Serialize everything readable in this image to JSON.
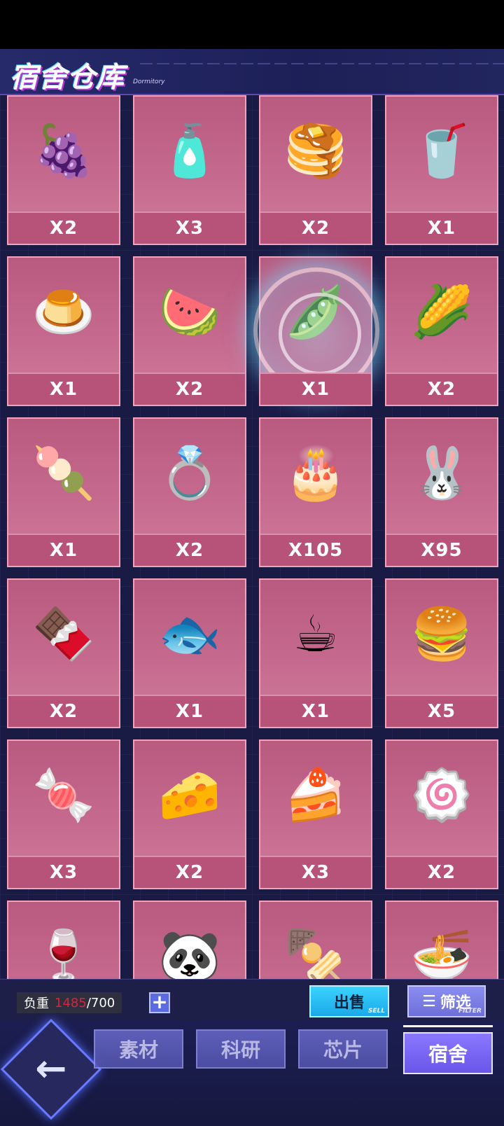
{
  "header": {
    "title": "宿舍仓库",
    "subtitle": "Dormitory"
  },
  "items": [
    {
      "icon": "🍇",
      "qty": "X2"
    },
    {
      "icon": "🧴",
      "qty": "X3"
    },
    {
      "icon": "🥞",
      "qty": "X2"
    },
    {
      "icon": "🥤",
      "qty": "X1"
    },
    {
      "icon": "🍮",
      "qty": "X1"
    },
    {
      "icon": "🍉",
      "qty": "X2"
    },
    {
      "icon": "🫛",
      "qty": "X1"
    },
    {
      "icon": "🌽",
      "qty": "X2"
    },
    {
      "icon": "🍡",
      "qty": "X1"
    },
    {
      "icon": "💍",
      "qty": "X2"
    },
    {
      "icon": "🎂",
      "qty": "X105"
    },
    {
      "icon": "🐰",
      "qty": "X95"
    },
    {
      "icon": "🍫",
      "qty": "X2"
    },
    {
      "icon": "🐟",
      "qty": "X1"
    },
    {
      "icon": "☕",
      "qty": "X1"
    },
    {
      "icon": "🍔",
      "qty": "X5"
    },
    {
      "icon": "🍬",
      "qty": "X3"
    },
    {
      "icon": "🧀",
      "qty": "X2"
    },
    {
      "icon": "🍰",
      "qty": "X3"
    },
    {
      "icon": "🍥",
      "qty": "X2"
    },
    {
      "icon": "🍷",
      "qty": ""
    },
    {
      "icon": "🐼",
      "qty": ""
    },
    {
      "icon": "🍢",
      "qty": ""
    },
    {
      "icon": "🍜",
      "qty": ""
    }
  ],
  "footer": {
    "weight_label": "负重",
    "weight_current": "1485",
    "weight_max": "/700",
    "plus_label": "+",
    "sell_label": "出售",
    "sell_sub": "SELL",
    "filter_label": "筛选",
    "filter_sub": "FILTER"
  },
  "nav": {
    "back_label": "←",
    "tabs": [
      {
        "label": "素材"
      },
      {
        "label": "科研"
      },
      {
        "label": "芯片"
      },
      {
        "label": "宿舍"
      }
    ],
    "active_tab": "宿舍"
  }
}
